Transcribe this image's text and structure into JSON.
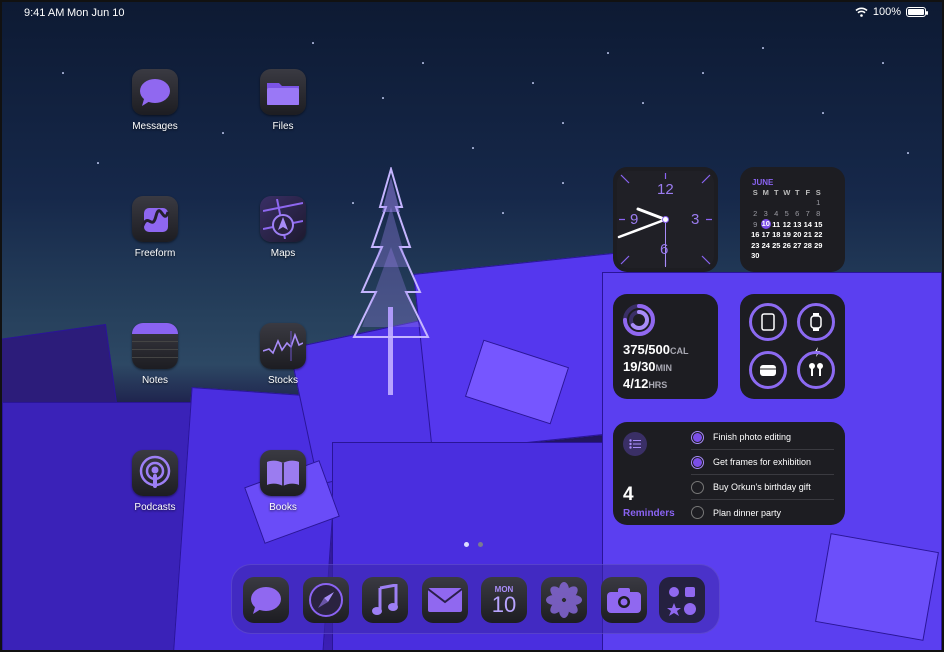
{
  "status_bar": {
    "time": "9:41 AM",
    "date": "Mon Jun 10",
    "battery": "100%"
  },
  "apps": [
    {
      "label": "Messages",
      "icon": "messages-icon"
    },
    {
      "label": "Files",
      "icon": "files-icon"
    },
    {
      "label": "Freeform",
      "icon": "freeform-icon"
    },
    {
      "label": "Maps",
      "icon": "maps-icon"
    },
    {
      "label": "Notes",
      "icon": "notes-icon"
    },
    {
      "label": "Stocks",
      "icon": "stocks-icon"
    },
    {
      "label": "Podcasts",
      "icon": "podcasts-icon"
    },
    {
      "label": "Books",
      "icon": "books-icon"
    }
  ],
  "clock_widget": {
    "numerals": [
      "12",
      "3",
      "6",
      "9"
    ]
  },
  "calendar_widget": {
    "month": "JUNE",
    "weekday_headers": [
      "S",
      "M",
      "T",
      "W",
      "T",
      "F",
      "S"
    ],
    "days": [
      "",
      "",
      "",
      "",
      "",
      "",
      "1",
      "2",
      "3",
      "4",
      "5",
      "6",
      "7",
      "8",
      "9",
      "10",
      "11",
      "12",
      "13",
      "14",
      "15",
      "16",
      "17",
      "18",
      "19",
      "20",
      "21",
      "22",
      "23",
      "24",
      "25",
      "26",
      "27",
      "28",
      "29",
      "30"
    ],
    "today": "10"
  },
  "fitness_widget": {
    "move_value": "375/500",
    "move_unit": "CAL",
    "exercise_value": "19/30",
    "exercise_unit": "MIN",
    "stand_value": "4/12",
    "stand_unit": "HRS"
  },
  "batteries_widget": {
    "devices": [
      "ipad-icon",
      "watch-icon",
      "case-icon",
      "airpods-icon"
    ]
  },
  "reminders_widget": {
    "count": "4",
    "title": "Reminders",
    "items": [
      {
        "text": "Finish photo editing",
        "done": true
      },
      {
        "text": "Get frames for exhibition",
        "done": true
      },
      {
        "text": "Buy Orkun's birthday gift",
        "done": false
      },
      {
        "text": "Plan dinner party",
        "done": false
      }
    ]
  },
  "dock": {
    "apps": [
      "messages-icon",
      "safari-icon",
      "music-icon",
      "mail-icon",
      "calendar-icon",
      "photos-icon",
      "camera-icon",
      "utilities-folder-icon"
    ],
    "calendar_day": "MON",
    "calendar_date": "10"
  },
  "colors": {
    "accent": "#8a63f2",
    "widget_bg": "#1d1d22"
  }
}
